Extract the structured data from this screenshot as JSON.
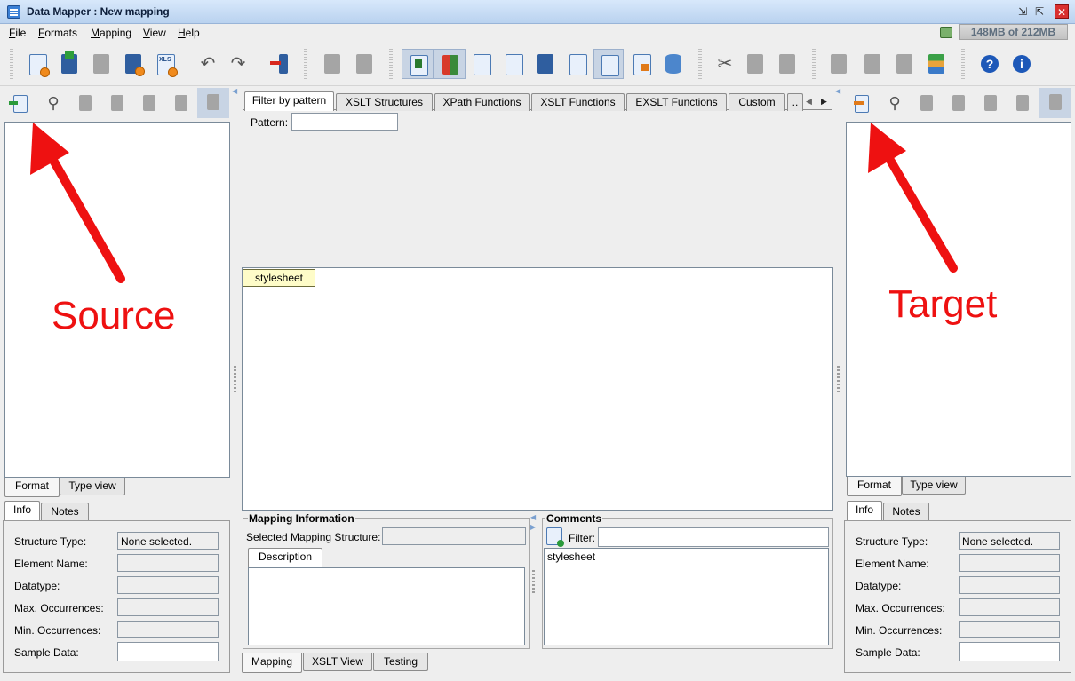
{
  "window": {
    "title": "Data Mapper : New mapping",
    "close_glyph": "✕",
    "minimize_glyph": "⇲",
    "maximize_glyph": "⇱"
  },
  "menu": {
    "items": [
      {
        "label": "File",
        "mnemonic": "F",
        "rest": "ile"
      },
      {
        "label": "Formats",
        "mnemonic": "F",
        "rest": "ormats"
      },
      {
        "label": "Mapping",
        "mnemonic": "M",
        "rest": "apping"
      },
      {
        "label": "View",
        "mnemonic": "V",
        "rest": "iew"
      },
      {
        "label": "Help",
        "mnemonic": "H",
        "rest": "elp"
      }
    ],
    "memory": "148MB of 212MB"
  },
  "toolbar": {
    "icons": [
      "new-mapping-icon",
      "open-mapping-icon",
      "save-icon",
      "save-as-icon",
      "export-xls-icon",
      "undo-icon",
      "redo-icon",
      "exit-icon",
      "disabled-a-icon",
      "disabled-b-icon",
      "info-view-icon",
      "color-view-icon",
      "list-view-icon",
      "code-view-icon",
      "save-output-icon",
      "document-icon",
      "xml-icon",
      "tree-icon",
      "database-icon",
      "cut-icon",
      "copy-icon",
      "paste-icon",
      "move-up-icon",
      "insert-icon",
      "move-down-icon",
      "format-icon",
      "help-icon",
      "about-icon"
    ],
    "xls_label": "XLS",
    "help_glyph": "?",
    "info_glyph": "i"
  },
  "source": {
    "annotation": "Source",
    "bottom_tabs": [
      "Format",
      "Type view"
    ],
    "info_tabs": [
      "Info",
      "Notes"
    ],
    "fields": [
      {
        "label": "Structure Type:",
        "value": "None selected."
      },
      {
        "label": "Element Name:",
        "value": ""
      },
      {
        "label": "Datatype:",
        "value": ""
      },
      {
        "label": "Max. Occurrences:",
        "value": ""
      },
      {
        "label": "Min. Occurrences:",
        "value": ""
      },
      {
        "label": "Sample Data:",
        "value": ""
      }
    ]
  },
  "target": {
    "annotation": "Target",
    "bottom_tabs": [
      "Format",
      "Type view"
    ],
    "info_tabs": [
      "Info",
      "Notes"
    ],
    "fields": [
      {
        "label": "Structure Type:",
        "value": "None selected."
      },
      {
        "label": "Element Name:",
        "value": ""
      },
      {
        "label": "Datatype:",
        "value": ""
      },
      {
        "label": "Max. Occurrences:",
        "value": ""
      },
      {
        "label": "Min. Occurrences:",
        "value": ""
      },
      {
        "label": "Sample Data:",
        "value": ""
      }
    ]
  },
  "center": {
    "function_tabs": [
      "Filter by pattern",
      "XSLT Structures",
      "XPath Functions",
      "XSLT Functions",
      "EXSLT Functions",
      "Custom",
      ".."
    ],
    "pattern_label": "Pattern:",
    "pattern_value": "",
    "stylesheet_node": "stylesheet",
    "mapping_info_title": "Mapping Information",
    "selected_structure_label": "Selected Mapping Structure:",
    "selected_structure_value": "",
    "description_tab": "Description",
    "comments_title": "Comments",
    "filter_label": "Filter:",
    "filter_value": "",
    "comment_item": "stylesheet",
    "bottom_tabs": [
      "Mapping",
      "XSLT View",
      "Testing"
    ]
  }
}
